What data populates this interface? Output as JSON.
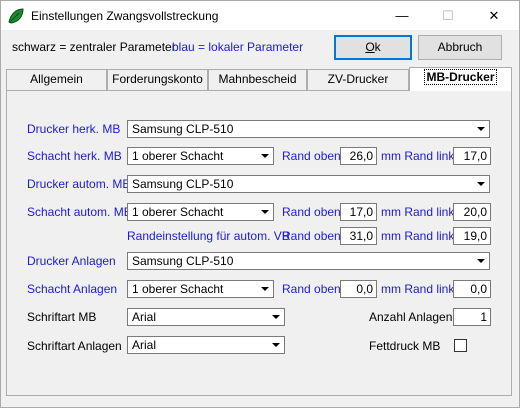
{
  "window": {
    "title": "Einstellungen Zwangsvollstreckung",
    "minimize_glyph": "—",
    "maximize_glyph": "☐",
    "close_glyph": "✕",
    "app_icon": "green-leaf-icon"
  },
  "legend": {
    "black": "schwarz = zentraler Parameter",
    "blue": "blau = lokaler Parameter"
  },
  "buttons": {
    "ok_mnemonic": "O",
    "ok_rest": "k",
    "cancel": "Abbruch"
  },
  "tabs": [
    "Allgemein",
    "Forderungskonto",
    "Mahnbescheid",
    "ZV-Drucker",
    "MB-Drucker"
  ],
  "active_tab": "MB-Drucker",
  "form": {
    "drucker_herk_label": "Drucker herk. MB",
    "drucker_herk_value": "Samsung CLP-510",
    "schacht_herk_label": "Schacht herk. MB",
    "schacht_herk_value": "1 oberer Schacht",
    "schacht_herk_rand_oben_label": "Rand oben",
    "schacht_herk_rand_oben": "26,0",
    "schacht_herk_rand_links_label": "mm Rand links",
    "schacht_herk_rand_links": "17,0",
    "drucker_autom_label": "Drucker autom. MB",
    "drucker_autom_value": "Samsung CLP-510",
    "schacht_autom_label": "Schacht autom. MB",
    "schacht_autom_value": "1 oberer Schacht",
    "schacht_autom_rand_oben_label": "Rand oben",
    "schacht_autom_rand_oben": "17,0",
    "schacht_autom_rand_links_label": "mm Rand links",
    "schacht_autom_rand_links": "20,0",
    "randeinstellung_label": "Randeinstellung für autom. VB",
    "randeinstellung_rand_oben_label": "Rand oben",
    "randeinstellung_rand_oben": "31,0",
    "randeinstellung_rand_links_label": "mm Rand links",
    "randeinstellung_rand_links": "19,0",
    "drucker_anlagen_label": "Drucker Anlagen",
    "drucker_anlagen_value": "Samsung CLP-510",
    "schacht_anlagen_label": "Schacht Anlagen",
    "schacht_anlagen_value": "1 oberer Schacht",
    "schacht_anlagen_rand_oben_label": "Rand oben",
    "schacht_anlagen_rand_oben": "0,0",
    "schacht_anlagen_rand_links_label": "mm Rand links",
    "schacht_anlagen_rand_links": "0,0",
    "schriftart_mb_label": "Schriftart MB",
    "schriftart_mb_value": "Arial",
    "anzahl_anlagen_label": "Anzahl Anlagen",
    "anzahl_anlagen_value": "1",
    "schriftart_anlagen_label": "Schriftart Anlagen",
    "schriftart_anlagen_value": "Arial",
    "fettdruck_label": "Fettdruck MB",
    "fettdruck_checked": false
  },
  "colors": {
    "local_param_blue": "#1c1cd0",
    "ok_focus_border": "#0078d7",
    "icon_green": "#1e8a2e"
  }
}
